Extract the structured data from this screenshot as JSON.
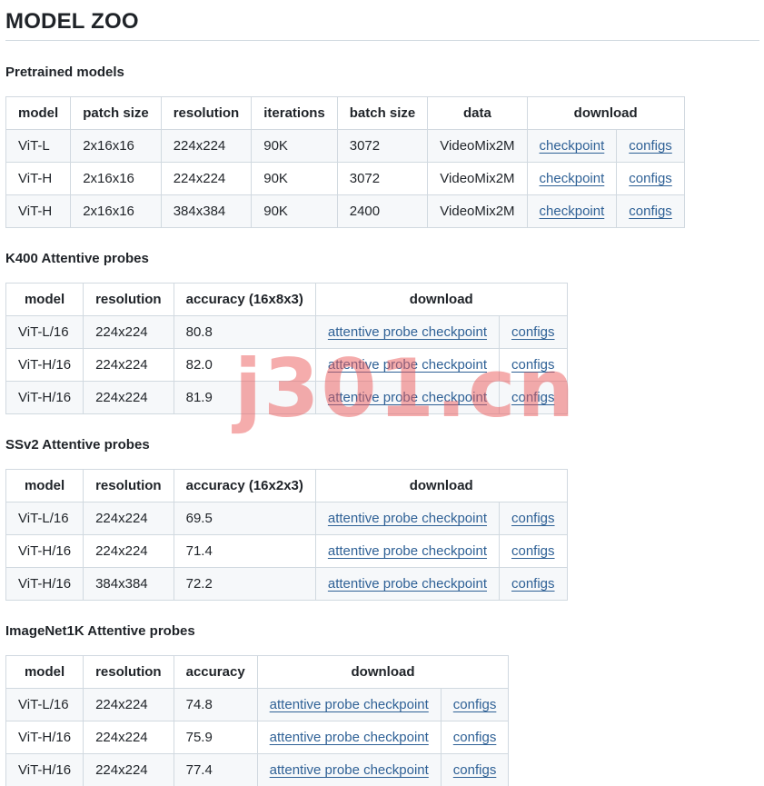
{
  "title": "MODEL ZOO",
  "watermark": "j301.cn",
  "pretrained": {
    "heading": "Pretrained models",
    "headers": [
      "model",
      "patch size",
      "resolution",
      "iterations",
      "batch size",
      "data",
      "download"
    ],
    "rows": [
      {
        "model": "ViT-L",
        "patch": "2x16x16",
        "resolution": "224x224",
        "iterations": "90K",
        "batch": "3072",
        "data": "VideoMix2M",
        "checkpoint": "checkpoint",
        "configs": "configs"
      },
      {
        "model": "ViT-H",
        "patch": "2x16x16",
        "resolution": "224x224",
        "iterations": "90K",
        "batch": "3072",
        "data": "VideoMix2M",
        "checkpoint": "checkpoint",
        "configs": "configs"
      },
      {
        "model": "ViT-H",
        "patch": "2x16x16",
        "resolution": "384x384",
        "iterations": "90K",
        "batch": "2400",
        "data": "VideoMix2M",
        "checkpoint": "checkpoint",
        "configs": "configs"
      }
    ]
  },
  "k400": {
    "heading": "K400 Attentive probes",
    "headers": [
      "model",
      "resolution",
      "accuracy (16x8x3)",
      "download"
    ],
    "rows": [
      {
        "model": "ViT-L/16",
        "resolution": "224x224",
        "accuracy": "80.8",
        "checkpoint": "attentive probe checkpoint",
        "configs": "configs"
      },
      {
        "model": "ViT-H/16",
        "resolution": "224x224",
        "accuracy": "82.0",
        "checkpoint": "attentive probe checkpoint",
        "configs": "configs"
      },
      {
        "model": "ViT-H/16",
        "resolution": "224x224",
        "accuracy": "81.9",
        "checkpoint": "attentive probe checkpoint",
        "configs": "configs"
      }
    ]
  },
  "ssv2": {
    "heading": "SSv2 Attentive probes",
    "headers": [
      "model",
      "resolution",
      "accuracy (16x2x3)",
      "download"
    ],
    "rows": [
      {
        "model": "ViT-L/16",
        "resolution": "224x224",
        "accuracy": "69.5",
        "checkpoint": "attentive probe checkpoint",
        "configs": "configs"
      },
      {
        "model": "ViT-H/16",
        "resolution": "224x224",
        "accuracy": "71.4",
        "checkpoint": "attentive probe checkpoint",
        "configs": "configs"
      },
      {
        "model": "ViT-H/16",
        "resolution": "384x384",
        "accuracy": "72.2",
        "checkpoint": "attentive probe checkpoint",
        "configs": "configs"
      }
    ]
  },
  "imagenet": {
    "heading": "ImageNet1K Attentive probes",
    "headers": [
      "model",
      "resolution",
      "accuracy",
      "download"
    ],
    "rows": [
      {
        "model": "ViT-L/16",
        "resolution": "224x224",
        "accuracy": "74.8",
        "checkpoint": "attentive probe checkpoint",
        "configs": "configs"
      },
      {
        "model": "ViT-H/16",
        "resolution": "224x224",
        "accuracy": "75.9",
        "checkpoint": "attentive probe checkpoint",
        "configs": "configs"
      },
      {
        "model": "ViT-H/16",
        "resolution": "224x224",
        "accuracy": "77.4",
        "checkpoint": "attentive probe checkpoint",
        "configs": "configs"
      }
    ]
  }
}
